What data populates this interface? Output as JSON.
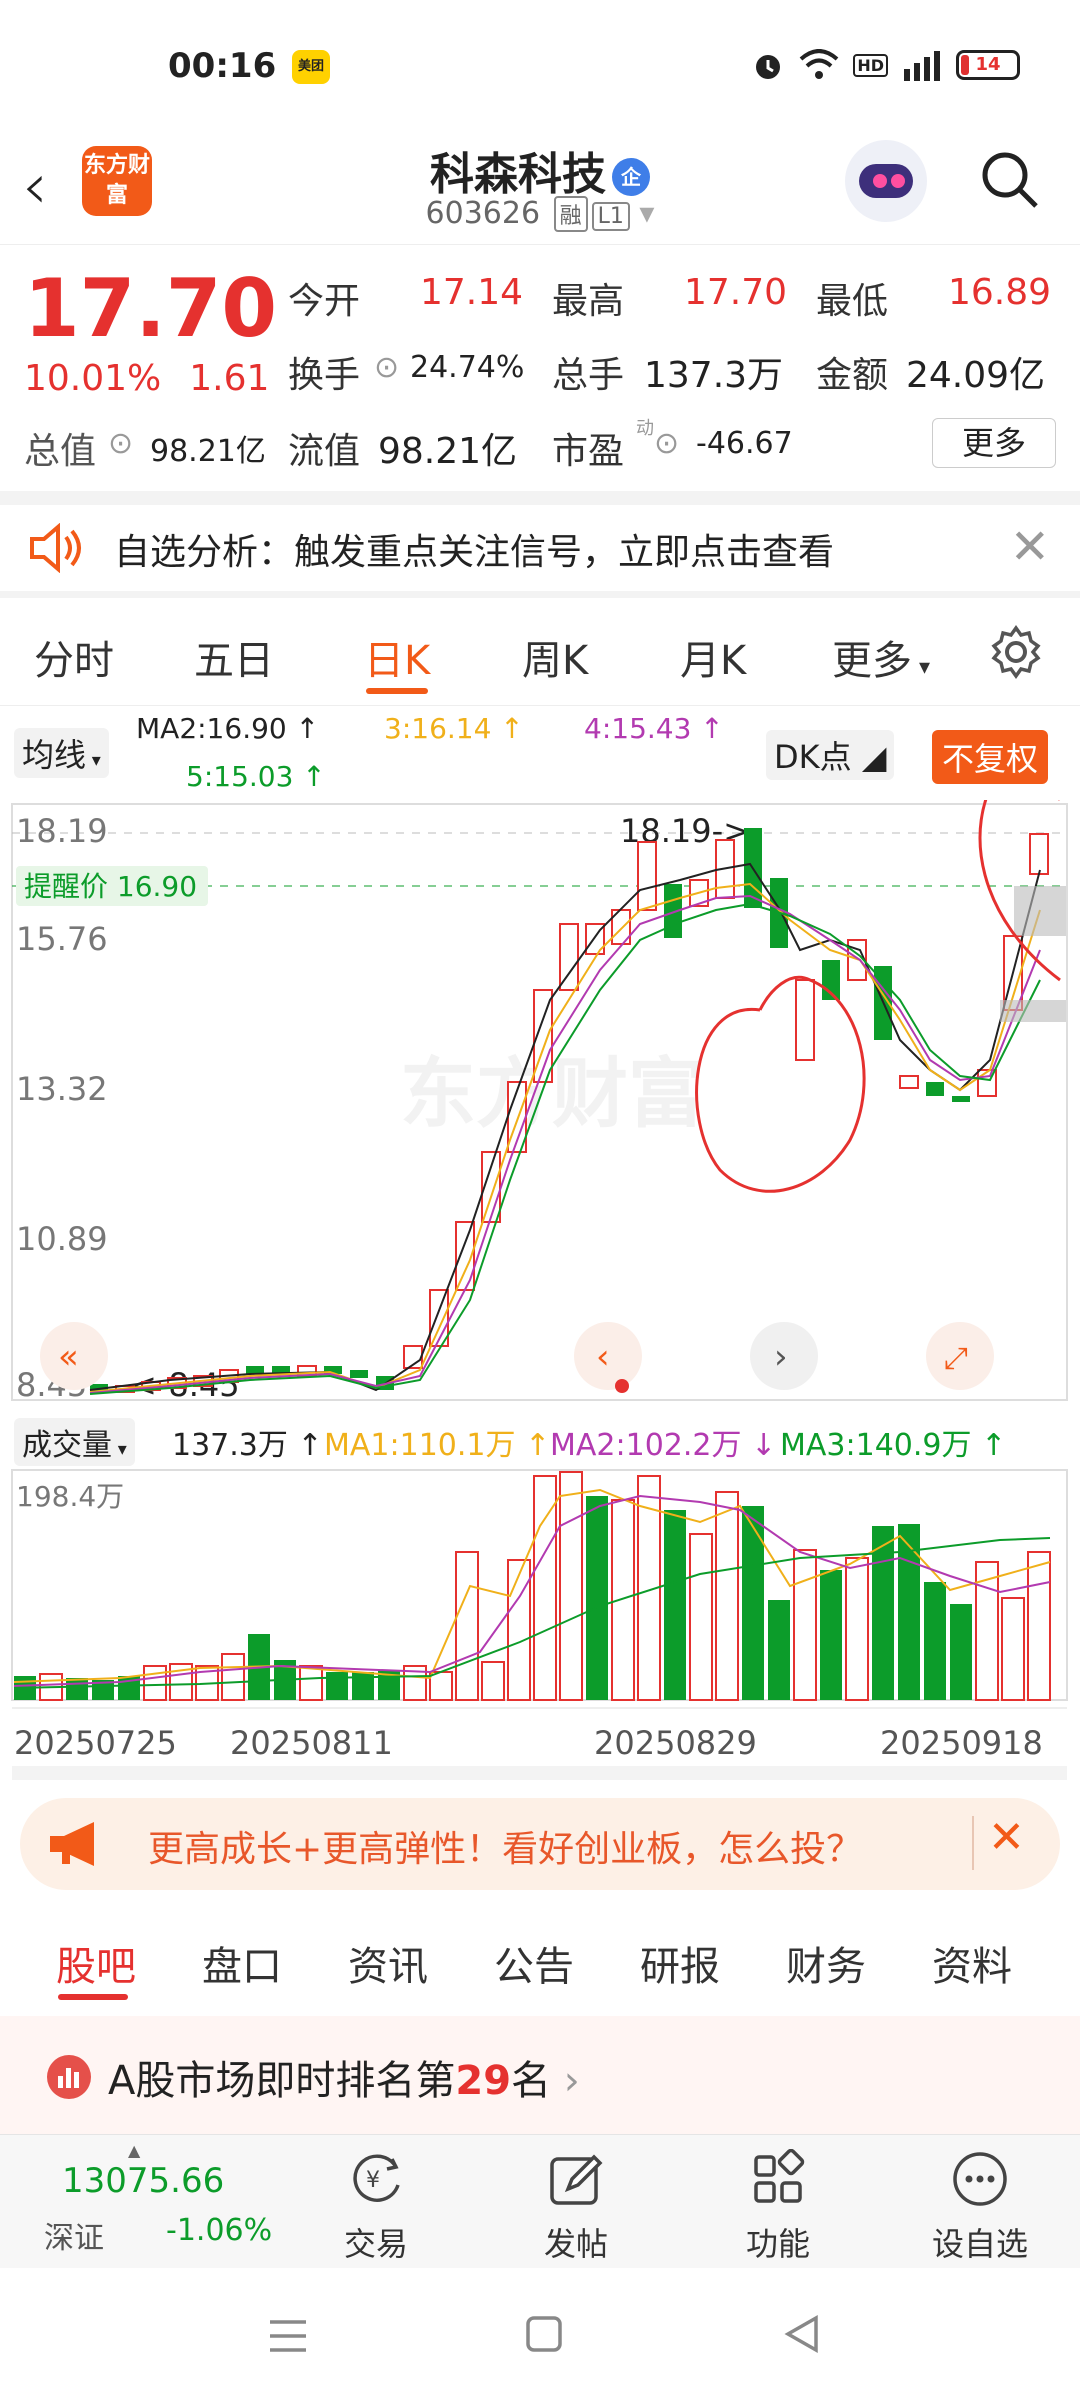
{
  "status": {
    "time": "00:16",
    "app_badge": "美团",
    "battery": "14"
  },
  "header": {
    "name": "科森科技",
    "badge": "企",
    "code": "603626",
    "tags": [
      "融",
      "L1"
    ],
    "logo": "东方财富"
  },
  "quote": {
    "price": "17.70",
    "pct": "10.01%",
    "chg": "1.61",
    "open_label": "今开",
    "open": "17.14",
    "high_label": "最高",
    "high": "17.70",
    "low_label": "最低",
    "low": "16.89",
    "turnover_label": "换手",
    "turnover": "24.74%",
    "volume_label": "总手",
    "volume": "137.3万",
    "amount_label": "金额",
    "amount": "24.09亿",
    "mcap_label": "总值",
    "mcap": "98.21亿",
    "float_label": "流值",
    "float": "98.21亿",
    "pe_label": "市盈",
    "pe_sup": "动",
    "pe": "-46.67",
    "more": "更多"
  },
  "notice": {
    "text": "自选分析：触发重点关注信号，立即点击查看"
  },
  "ktabs": [
    "分时",
    "五日",
    "日K",
    "周K",
    "月K",
    "更多"
  ],
  "ma": {
    "selector": "均线",
    "ma2": "MA2:16.90",
    "ma3": "3:16.14",
    "ma4": "4:15.43",
    "ma5": "5:15.03",
    "dk": "DK点",
    "fq": "不复权"
  },
  "price_axis": {
    "y1": "18.19",
    "y2": "15.76",
    "y3": "13.32",
    "y4": "10.89",
    "y5": "8.45",
    "alert": "提醒价 16.90",
    "hi_mark": "18.19",
    "lo_mark": "8.45"
  },
  "watermark": "东方财富",
  "vol": {
    "selector": "成交量",
    "cur": "137.3万",
    "ma1": "MA1:110.1万",
    "ma2": "MA2:102.2万",
    "ma3": "MA3:140.9万",
    "max": "198.4万"
  },
  "dates": [
    "20250725",
    "20250811",
    "20250829",
    "20250918"
  ],
  "colors": {
    "up": "#e5312f",
    "down": "#0c9c2a",
    "brand": "#f25a18"
  },
  "promo": {
    "text": "更高成长+更高弹性！看好创业板，怎么投？"
  },
  "btabs": [
    "股吧",
    "盘口",
    "资讯",
    "公告",
    "研报",
    "财务",
    "资料"
  ],
  "rank": {
    "prefix": "A股市场即时排名第",
    "num": "29",
    "suffix": "名"
  },
  "bnav": {
    "index_val": "13075.66",
    "index_name": "深证",
    "index_chg": "-1.06%",
    "items": [
      "交易",
      "发帖",
      "功能",
      "设自选"
    ]
  }
}
